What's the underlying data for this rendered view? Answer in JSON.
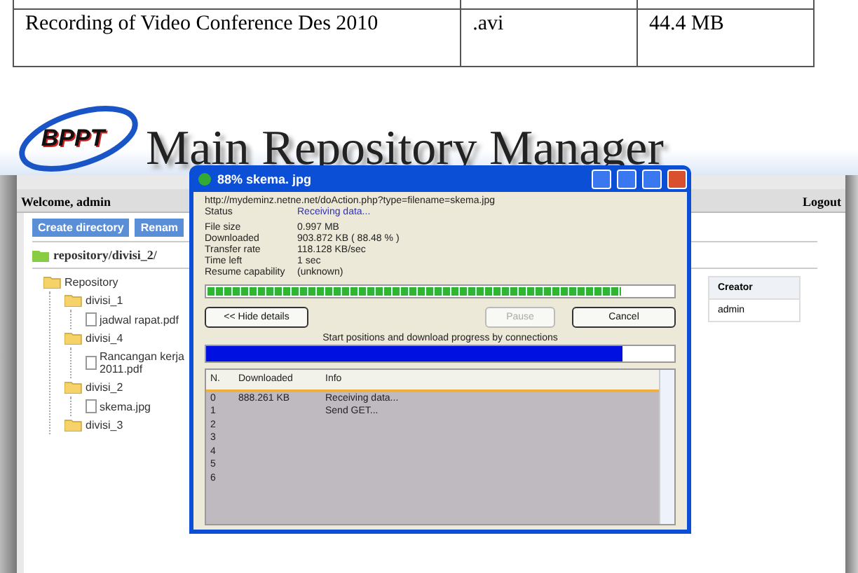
{
  "document_table": {
    "rows": [
      {
        "cells": [
          "Recording of Video Conference Des 2010",
          ".avi",
          "44.4 MB"
        ]
      }
    ]
  },
  "app": {
    "logo": "BPPT",
    "title": "Main Repository Manager",
    "welcome": "Welcome, admin",
    "logout": "Logout",
    "toolbar": [
      "Create directory",
      "Renam"
    ],
    "path": "repository/divisi_2/",
    "tree": [
      {
        "label": "Repository",
        "kind": "folder",
        "children": [
          {
            "label": "divisi_1",
            "kind": "folder",
            "children": [
              {
                "label": "jadwal rapat.pdf",
                "kind": "file"
              }
            ]
          },
          {
            "label": "divisi_4",
            "kind": "folder",
            "children": [
              {
                "label": "Rancangan kerja 2011.pdf",
                "kind": "file"
              }
            ]
          },
          {
            "label": "divisi_2",
            "kind": "folder",
            "children": [
              {
                "label": "skema.jpg",
                "kind": "file"
              }
            ]
          },
          {
            "label": "divisi_3",
            "kind": "folder"
          }
        ]
      }
    ],
    "files_table": {
      "columns": [
        "Creator"
      ],
      "rows": [
        [
          "admin"
        ]
      ]
    }
  },
  "dialog": {
    "title": "88% skema. jpg",
    "url": "http://mydeminz.netne.net/doAction.php?type=filename=skema.jpg",
    "status": {
      "label": "Status",
      "value": "Receiving data..."
    },
    "fields": [
      {
        "label": "File size",
        "value": "0.997  MB"
      },
      {
        "label": "Downloaded",
        "value": "903.872  KB  ( 88.48 % )"
      },
      {
        "label": "Transfer rate",
        "value": "118.128  KB/sec"
      },
      {
        "label": "Time left",
        "value": "1 sec"
      },
      {
        "label": "Resume capability",
        "value": "(unknown)"
      }
    ],
    "progress": {
      "level": 0.89
    },
    "buttons": [
      {
        "label": "<< Hide details",
        "disabled": false
      },
      {
        "label": "Pause",
        "disabled": true
      },
      {
        "label": "Cancel",
        "disabled": false
      }
    ],
    "connections_caption": "Start positions and download progress by connections",
    "connections_bar": {
      "level": 0.89
    },
    "list": {
      "columns": [
        "N.",
        "Downloaded",
        "Info"
      ],
      "rows": [
        [
          "0",
          "888.261  KB",
          "Receiving data..."
        ],
        [
          "1",
          "",
          "Send GET..."
        ],
        [
          "2",
          "",
          ""
        ],
        [
          "3",
          "",
          ""
        ],
        [
          "4",
          "",
          ""
        ],
        [
          "5",
          "",
          ""
        ],
        [
          "6",
          "",
          ""
        ]
      ]
    }
  }
}
